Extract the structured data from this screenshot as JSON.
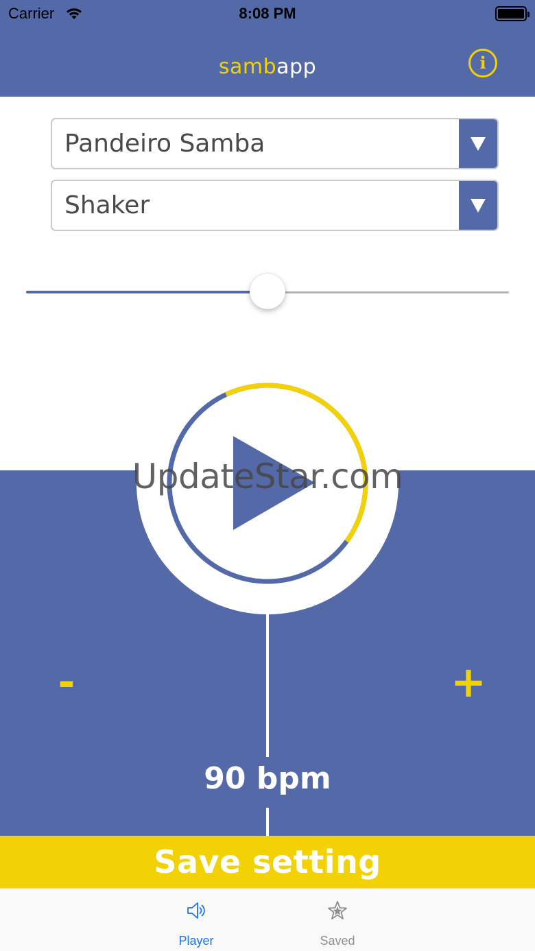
{
  "status_bar": {
    "carrier": "Carrier",
    "time": "8:08 PM"
  },
  "nav": {
    "title_part1": "samb",
    "title_part2": "app",
    "info_glyph": "i",
    "info_icon": "info-circle-icon"
  },
  "dropdowns": [
    {
      "label": "Pandeiro Samba",
      "icon": "triangle-down-icon"
    },
    {
      "label": "Shaker",
      "icon": "triangle-down-icon"
    }
  ],
  "slider": {
    "value_fraction": 0.5
  },
  "player": {
    "play_icon": "play-icon",
    "progress_fraction": 0.6,
    "minus_label": "-",
    "plus_label": "+",
    "bpm_label": "90 bpm"
  },
  "watermark": "UpdateStar.com",
  "save": {
    "label": "Save setting"
  },
  "tabs": [
    {
      "label": "Player",
      "icon": "speaker-icon",
      "active": true
    },
    {
      "label": "Saved",
      "icon": "star-icon",
      "active": false
    }
  ],
  "colors": {
    "primary_blue": "#5469a8",
    "accent_yellow": "#f2d204",
    "active_tab": "#1a73e8",
    "inactive_tab": "#8e8e8e"
  }
}
